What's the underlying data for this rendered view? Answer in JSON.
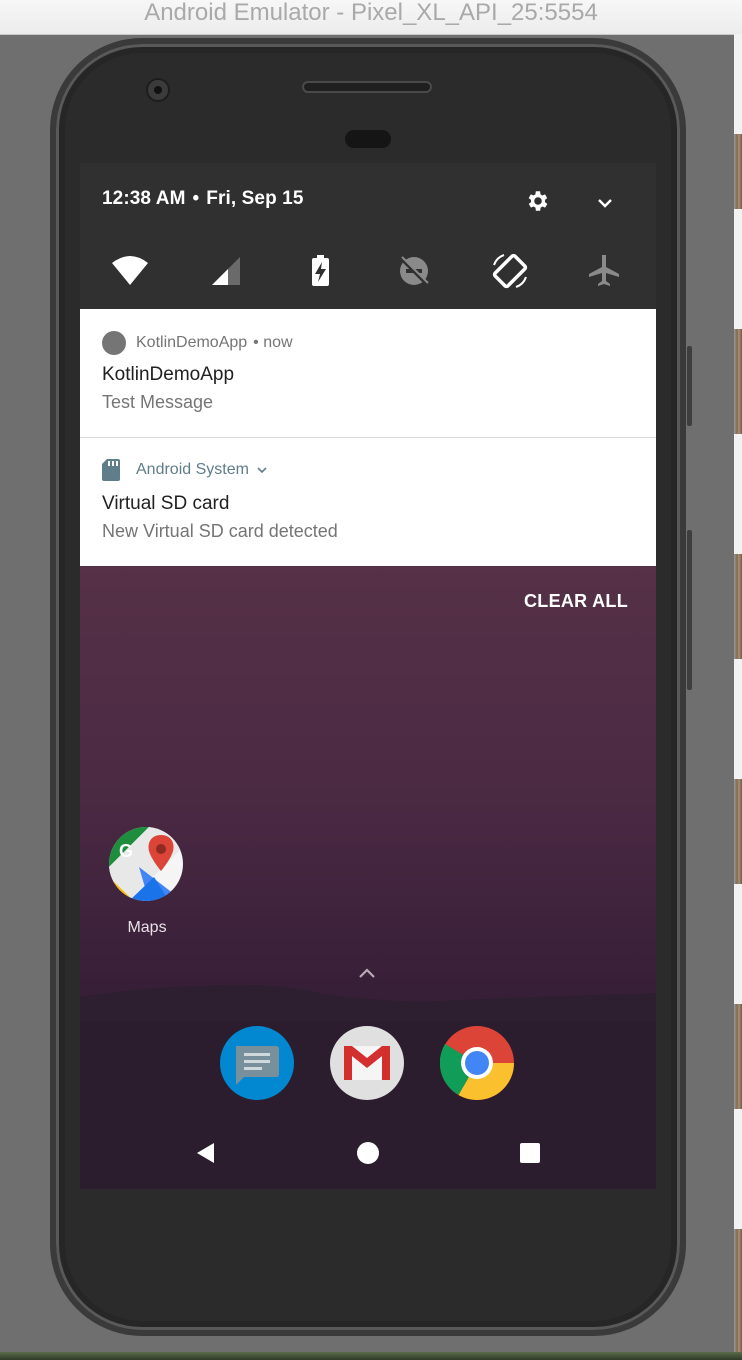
{
  "window": {
    "title": "Android Emulator - Pixel_XL_API_25:5554"
  },
  "status": {
    "time": "12:38 AM",
    "separator": "•",
    "date": "Fri, Sep 15"
  },
  "quick_settings": {
    "tiles": [
      "wifi",
      "cellular-signal",
      "battery-saver",
      "do-not-disturb-off",
      "auto-rotate",
      "airplane-mode"
    ]
  },
  "notifications": [
    {
      "app": "KotlinDemoApp",
      "time": "• now",
      "title": "KotlinDemoApp",
      "text": "Test Message",
      "icon": "grey-circle-icon"
    },
    {
      "app": "Android System",
      "title": "Virtual SD card",
      "text": "New Virtual SD card detected",
      "icon": "sd-card-icon",
      "accent": "#607d8b"
    }
  ],
  "actions": {
    "clear_all": "CLEAR ALL"
  },
  "home": {
    "app_label": "Maps",
    "dock": [
      "messages-icon",
      "gmail-icon",
      "chrome-icon"
    ]
  },
  "colors": {
    "header_bg": "#303030",
    "notif_accent": "#607d8b",
    "wallpaper_top": "#573449",
    "wallpaper_bottom": "#2a1a2c"
  }
}
